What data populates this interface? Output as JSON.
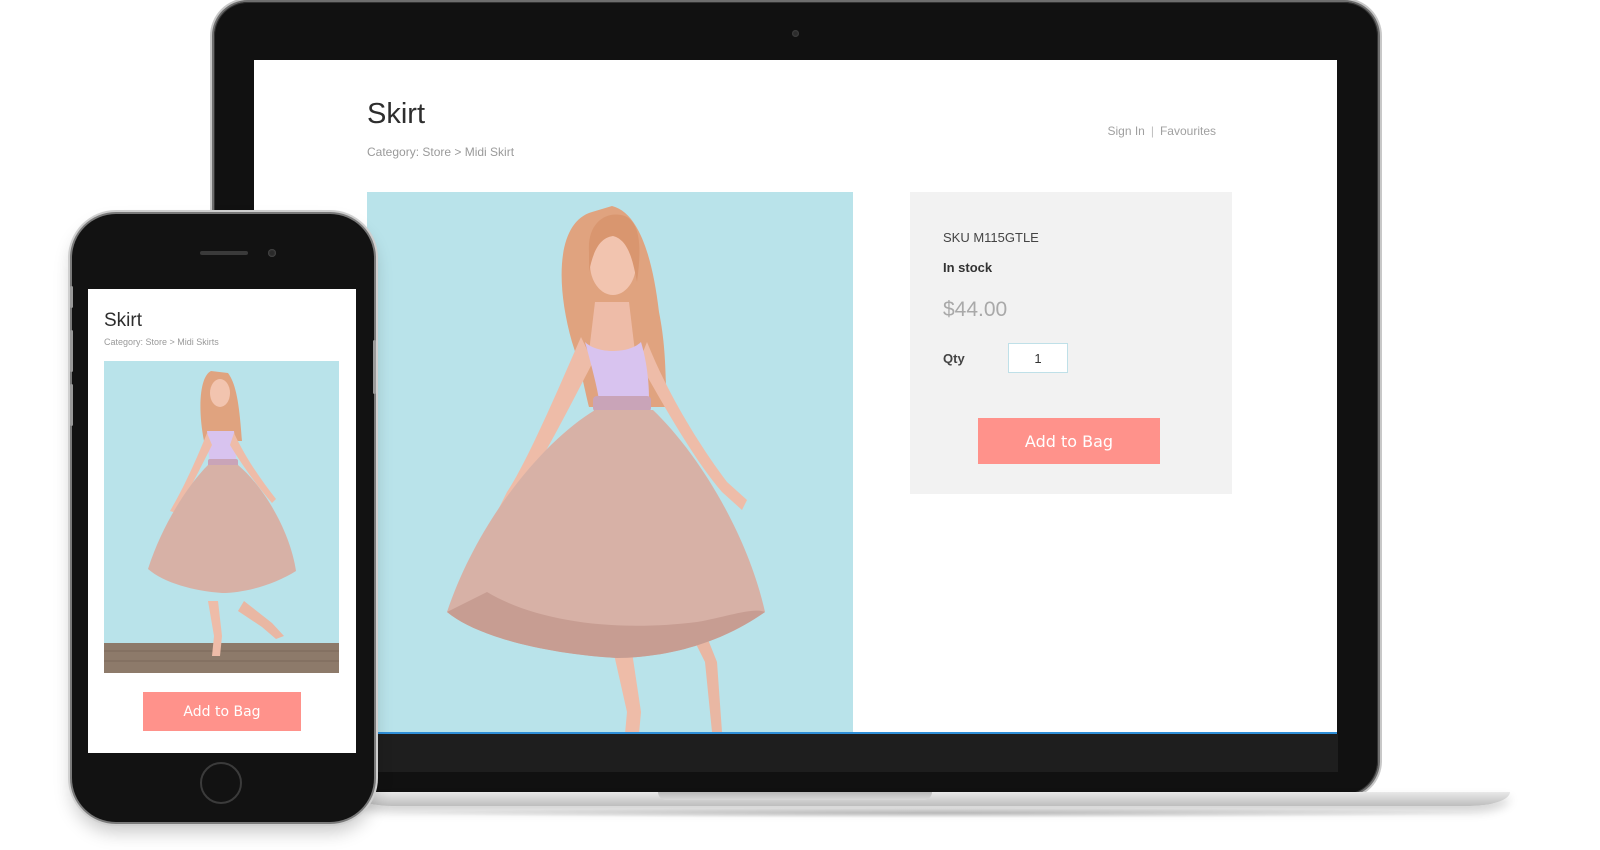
{
  "desktop": {
    "title": "Skirt",
    "breadcrumb": "Category: Store > Midi Skirt",
    "nav": {
      "sign_in": "Sign In",
      "separator": "|",
      "favourites": "Favourites"
    },
    "product": {
      "sku": "SKU M115GTLE",
      "stock": "In stock",
      "price": "$44.00",
      "qty_label": "Qty",
      "qty_value": "1",
      "add_to_bag": "Add to Bag"
    }
  },
  "mobile": {
    "title": "Skirt",
    "breadcrumb": "Category: Store >  Midi Skirts",
    "add_to_bag": "Add to Bag"
  },
  "colors": {
    "accent_button": "#ff928b",
    "photo_background": "#b9e3ea",
    "panel_background": "#f2f2f2",
    "floor": "#8d7a6a"
  }
}
